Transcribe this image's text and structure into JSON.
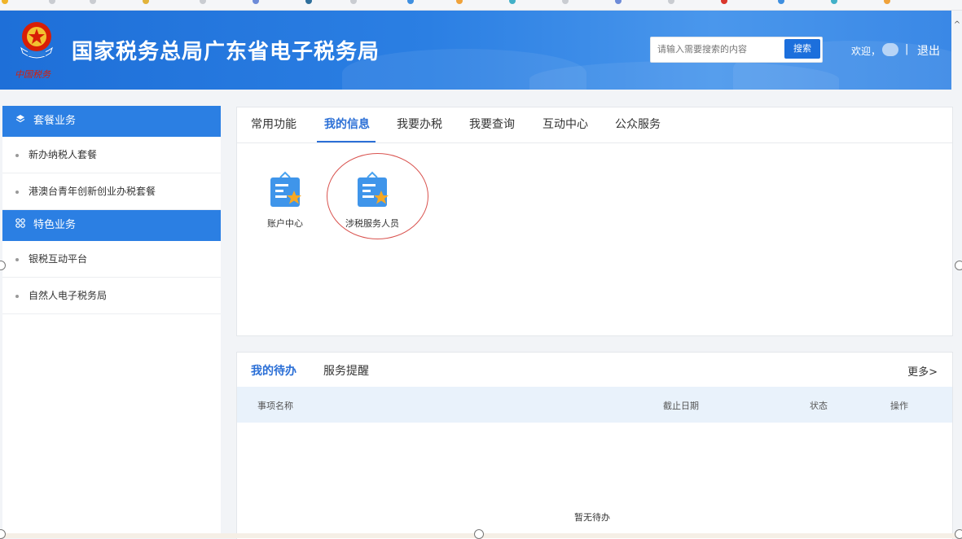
{
  "header": {
    "title": "国家税务总局广东省电子税务局",
    "emblem_caption": "中国税务",
    "search_placeholder": "请输入需要搜索的内容",
    "search_button": "搜索",
    "welcome": "欢迎，",
    "separator": "|",
    "logout": "退出"
  },
  "sidebar": {
    "groups": [
      {
        "title": "套餐业务",
        "icon": "layers-icon",
        "items": [
          "新办纳税人套餐",
          "港澳台青年创新创业办税套餐"
        ]
      },
      {
        "title": "特色业务",
        "icon": "grid-icon",
        "items": [
          "银税互动平台",
          "自然人电子税务局"
        ]
      }
    ]
  },
  "tabs": [
    "常用功能",
    "我的信息",
    "我要办税",
    "我要查询",
    "互动中心",
    "公众服务"
  ],
  "active_tab": "我的信息",
  "apps": [
    {
      "label": "账户中心",
      "icon": "doc-star-icon"
    },
    {
      "label": "涉税服务人员",
      "icon": "doc-star-icon"
    }
  ],
  "todo": {
    "tabs": [
      "我的待办",
      "服务提醒"
    ],
    "more": "更多>",
    "columns": [
      "事项名称",
      "截止日期",
      "状态",
      "操作"
    ],
    "empty": "暂无待办"
  },
  "colors": {
    "primary": "#2b7fe3",
    "accent": "#2b6fd6",
    "highlight_ring": "#d9534f",
    "icon_star": "#f7a823"
  }
}
